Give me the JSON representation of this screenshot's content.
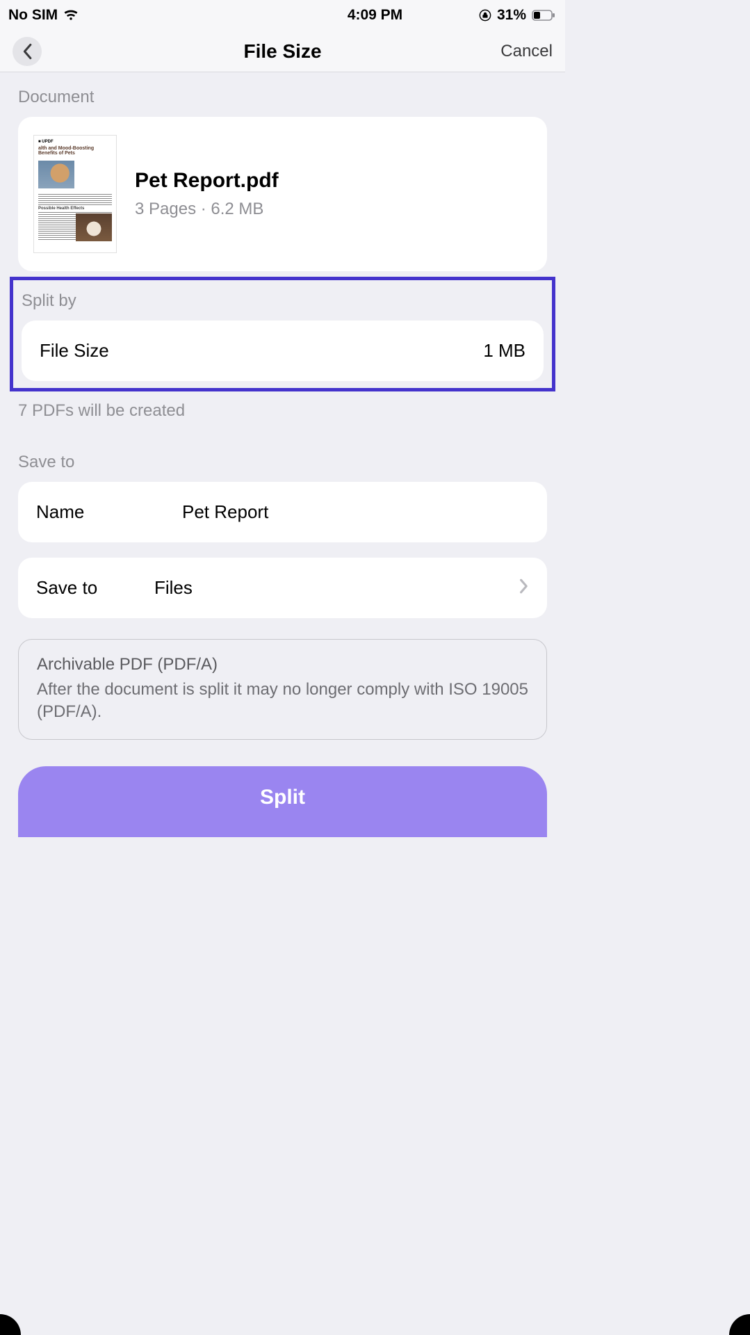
{
  "status": {
    "carrier": "No SIM",
    "time": "4:09 PM",
    "battery_pct": "31%"
  },
  "nav": {
    "title": "File Size",
    "cancel": "Cancel"
  },
  "doc": {
    "section": "Document",
    "name": "Pet Report.pdf",
    "sub": "3 Pages  ·  6.2 MB",
    "thumb_heading": "alth and Mood-Boosting Benefits of Pets",
    "thumb_logo": "■ UPDF"
  },
  "split": {
    "section": "Split by",
    "label": "File Size",
    "value": "1 MB",
    "result": "7 PDFs will be created"
  },
  "save": {
    "section": "Save to",
    "name_label": "Name",
    "name_value": "Pet Report",
    "dest_label": "Save to",
    "dest_value": "Files"
  },
  "info": {
    "title": "Archivable PDF (PDF/A)",
    "body": "After the document is split it may no longer comply with ISO 19005 (PDF/A)."
  },
  "action": {
    "split": "Split"
  }
}
